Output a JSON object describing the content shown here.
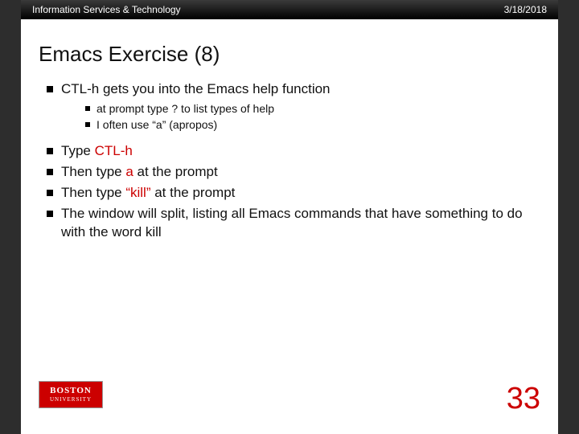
{
  "header": {
    "left": "Information Services & Technology",
    "right": "3/18/2018"
  },
  "title": "Emacs Exercise (8)",
  "bullet_main": "CTL-h gets you into the Emacs help function",
  "sub_bullets": [
    "at prompt type ? to list types of help",
    "I often use “a” (apropos)"
  ],
  "steps": [
    {
      "pre": "Type ",
      "red": "CTL-h",
      "post": ""
    },
    {
      "pre": "Then type ",
      "red": "a",
      "post": " at the prompt"
    },
    {
      "pre": "Then type ",
      "red": "“kill”",
      "post": " at the prompt"
    },
    {
      "pre": "The window will split, listing all Emacs commands that have something to do with the word kill",
      "red": "",
      "post": ""
    }
  ],
  "logo": {
    "line1": "BOSTON",
    "line2": "UNIVERSITY"
  },
  "page_number": "33"
}
